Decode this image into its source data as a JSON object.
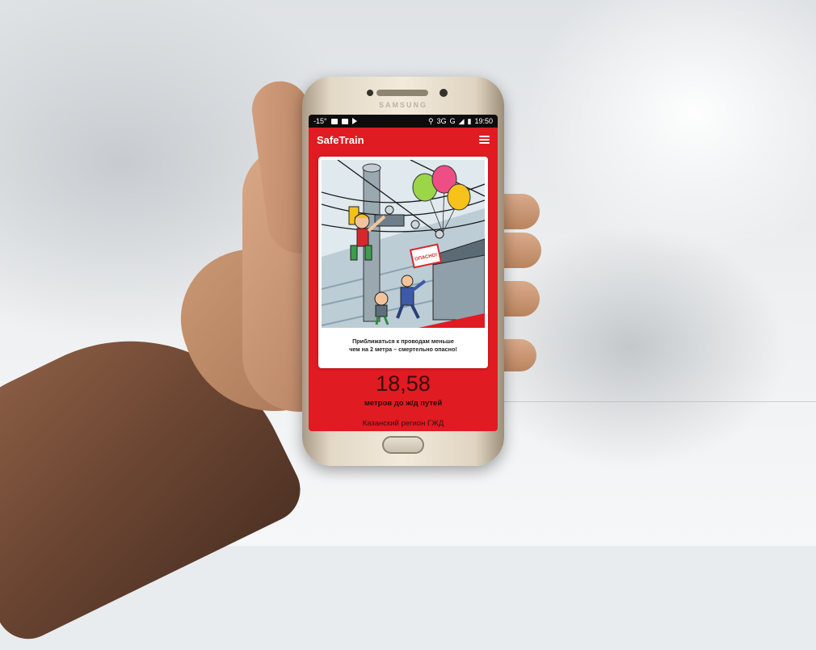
{
  "status_bar": {
    "temperature": "-15°",
    "network": "3G",
    "carrier": "G",
    "time": "19:50"
  },
  "phone": {
    "brand": "SAMSUNG"
  },
  "app": {
    "title": "SafeTrain"
  },
  "card": {
    "sign_text": "ОПАСНО!",
    "caption_line1": "Приближаться к проводам меньше",
    "caption_line2": "чем на 2 метра – смертельно опасно!"
  },
  "info": {
    "distance": "18,58",
    "distance_unit": "метров до ж/д путей",
    "region": "Казанский регион ГЖД"
  },
  "colors": {
    "accent": "#e01b22",
    "status_bar": "#0d0d0d"
  }
}
